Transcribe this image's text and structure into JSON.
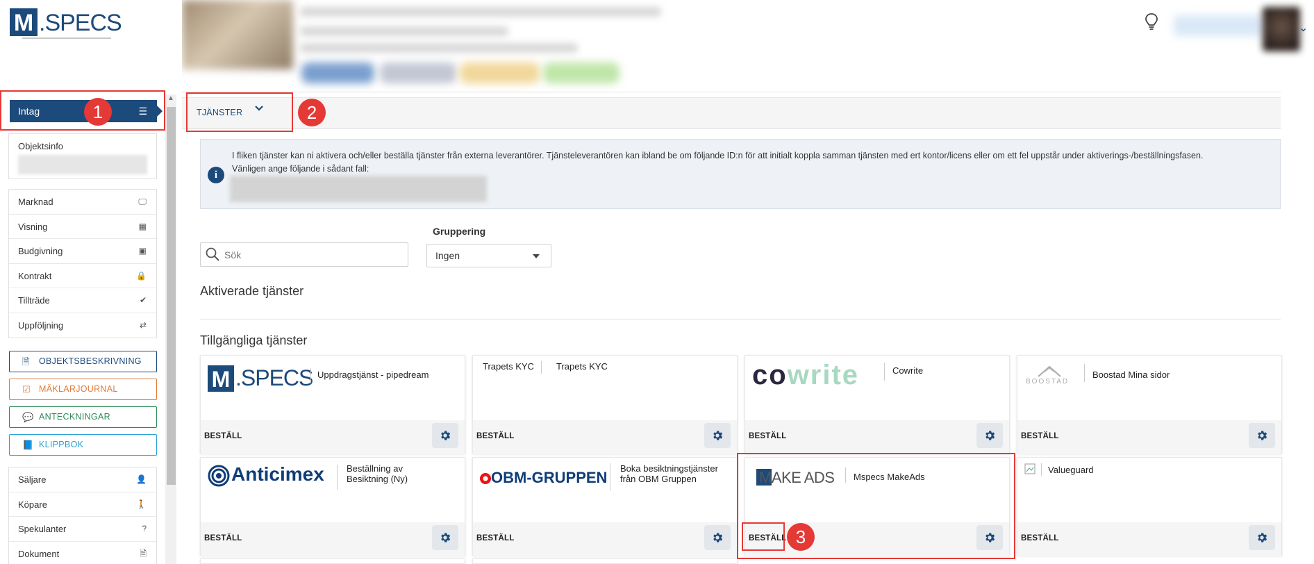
{
  "logo": {
    "m": "M",
    "specs": ".SPECS"
  },
  "sidebar": {
    "intag_label": "Intag",
    "objektsinfo_label": "Objektsinfo",
    "menu": [
      {
        "label": "Marknad",
        "icon": "monitor-icon",
        "glyph": "🖵"
      },
      {
        "label": "Visning",
        "icon": "calendar-icon",
        "glyph": "▦"
      },
      {
        "label": "Budgivning",
        "icon": "money-icon",
        "glyph": "▣"
      },
      {
        "label": "Kontrakt",
        "icon": "lock-icon",
        "glyph": "🔒"
      },
      {
        "label": "Tillträde",
        "icon": "check-icon",
        "glyph": "✔"
      },
      {
        "label": "Uppföljning",
        "icon": "swap-icon",
        "glyph": "⇄"
      }
    ],
    "buttons": [
      {
        "label": "OBJEKTSBESKRIVNING",
        "color": "#1c4a7a",
        "icon": "document-icon",
        "glyph": "🗎"
      },
      {
        "label": "MÄKLARJOURNAL",
        "color": "#e07b39",
        "icon": "checkbox-icon",
        "glyph": "☑"
      },
      {
        "label": "ANTECKNINGAR",
        "color": "#2e8b57",
        "icon": "comment-icon",
        "glyph": "💬"
      },
      {
        "label": "KLIPPBOK",
        "color": "#2a9fd6",
        "icon": "book-icon",
        "glyph": "📘"
      }
    ],
    "menu2": [
      {
        "label": "Säljare",
        "icon": "user-icon",
        "glyph": "👤"
      },
      {
        "label": "Köpare",
        "icon": "person-icon",
        "glyph": "🚶"
      },
      {
        "label": "Spekulanter",
        "icon": "question-icon",
        "glyph": "?"
      },
      {
        "label": "Dokument",
        "icon": "file-icon",
        "glyph": "🗎"
      }
    ]
  },
  "main": {
    "tab_label": "TJÄNSTER",
    "info_text_1": "I fliken tjänster kan ni aktivera och/eller beställa tjänster från externa leverantörer. Tjänsteleverantören kan ibland be om följande ID:n för att initialt koppla samman tjänsten med ert kontor/licens eller om ett fel uppstår under aktiverings-/beställningsfasen.",
    "info_text_2": "Vänligen ange följande i sådant fall:",
    "search_placeholder": "Sök",
    "grouping_label": "Gruppering",
    "grouping_value": "Ingen",
    "activated_heading": "Aktiverade tjänster",
    "available_heading": "Tillgängliga tjänster",
    "order_label": "BESTÄLL",
    "services": [
      {
        "logo": "M.SPECS",
        "title": "Uppdragstjänst - pipedream"
      },
      {
        "logo": "Trapets KYC",
        "title": "Trapets KYC"
      },
      {
        "logo": "cowrite",
        "title": "Cowrite"
      },
      {
        "logo": "BOOSTAD",
        "title": "Boostad Mina sidor"
      },
      {
        "logo": "Anticimex",
        "title": "Beställning av Besiktning (Ny)"
      },
      {
        "logo": "OBM-GRUPPEN",
        "title": "Boka besiktningstjänster från OBM Gruppen"
      },
      {
        "logo": "MAKE ADS",
        "title": "Mspecs MakeAds"
      },
      {
        "logo": "",
        "title": "Valueguard"
      }
    ]
  },
  "annotations": {
    "badge1": "1",
    "badge2": "2",
    "badge3": "3"
  },
  "colors": {
    "brand": "#1c4a7a",
    "highlight": "#e53935"
  }
}
